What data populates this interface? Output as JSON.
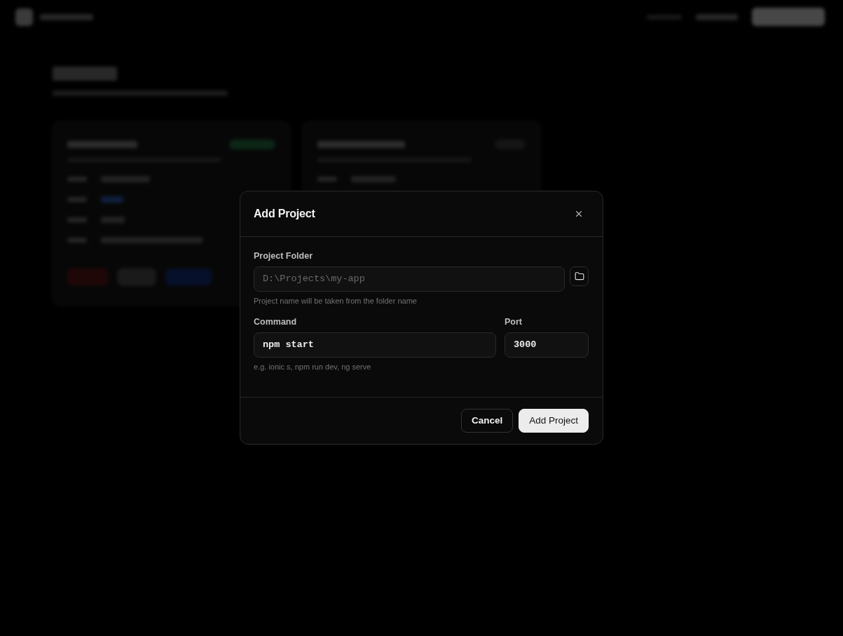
{
  "dialog": {
    "title": "Add Project",
    "rows": [
      {
        "fields": [
          {
            "kind": "path",
            "label": "Project Folder",
            "placeholder": "D:\\Projects\\my-app",
            "hint": "Project name will be taken from the folder name"
          }
        ]
      },
      {
        "fields": [
          {
            "kind": "text",
            "label": "Command",
            "value": "npm start",
            "hint": "e.g. ionic s, npm run dev, ng serve"
          },
          {
            "kind": "number",
            "label": "Port",
            "value": "3000"
          }
        ]
      }
    ],
    "buttons": [
      {
        "label": "Cancel",
        "kind": "secondary"
      },
      {
        "label": "Add Project",
        "kind": "primary"
      }
    ]
  }
}
